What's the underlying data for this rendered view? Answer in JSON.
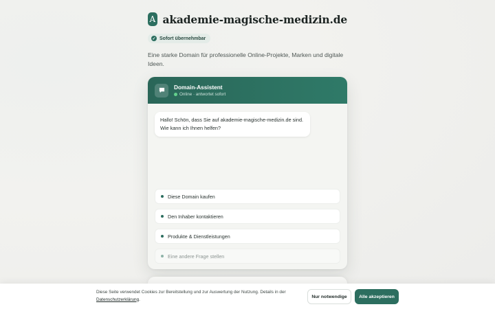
{
  "header": {
    "logo_letter": "A",
    "domain": "akademie-magische-medizin.de",
    "badge": "Sofort übernehmbar",
    "tagline": "Eine starke Domain für professionelle Online-Projekte, Marken und digitale Ideen."
  },
  "chat": {
    "title": "Domain-Assistent",
    "status": "Online · antwortet sofort",
    "greeting": "Hallo! Schön, dass Sie auf akademie-magische-medizin.de sind. Wie kann ich Ihnen helfen?",
    "options": [
      "Diese Domain kaufen",
      "Den Inhaber kontaktieren",
      "Produkte & Dienstleistungen",
      "Eine andere Frage stellen"
    ]
  },
  "cookie": {
    "text": "Diese Seite verwendet Cookies zur Bereitstellung und zur Auswertung der Nutzung. Details in der",
    "link": "Datenschutzerklärung",
    "link_suffix": ".",
    "btn_necessary": "Nur notwendige",
    "btn_accept": "Alle akzeptieren"
  },
  "colors": {
    "accent": "#2c6e5f",
    "online": "#63d08c"
  },
  "icons": {
    "badge": "check-circle-icon",
    "chat_avatar": "chat-bubble-icon"
  }
}
